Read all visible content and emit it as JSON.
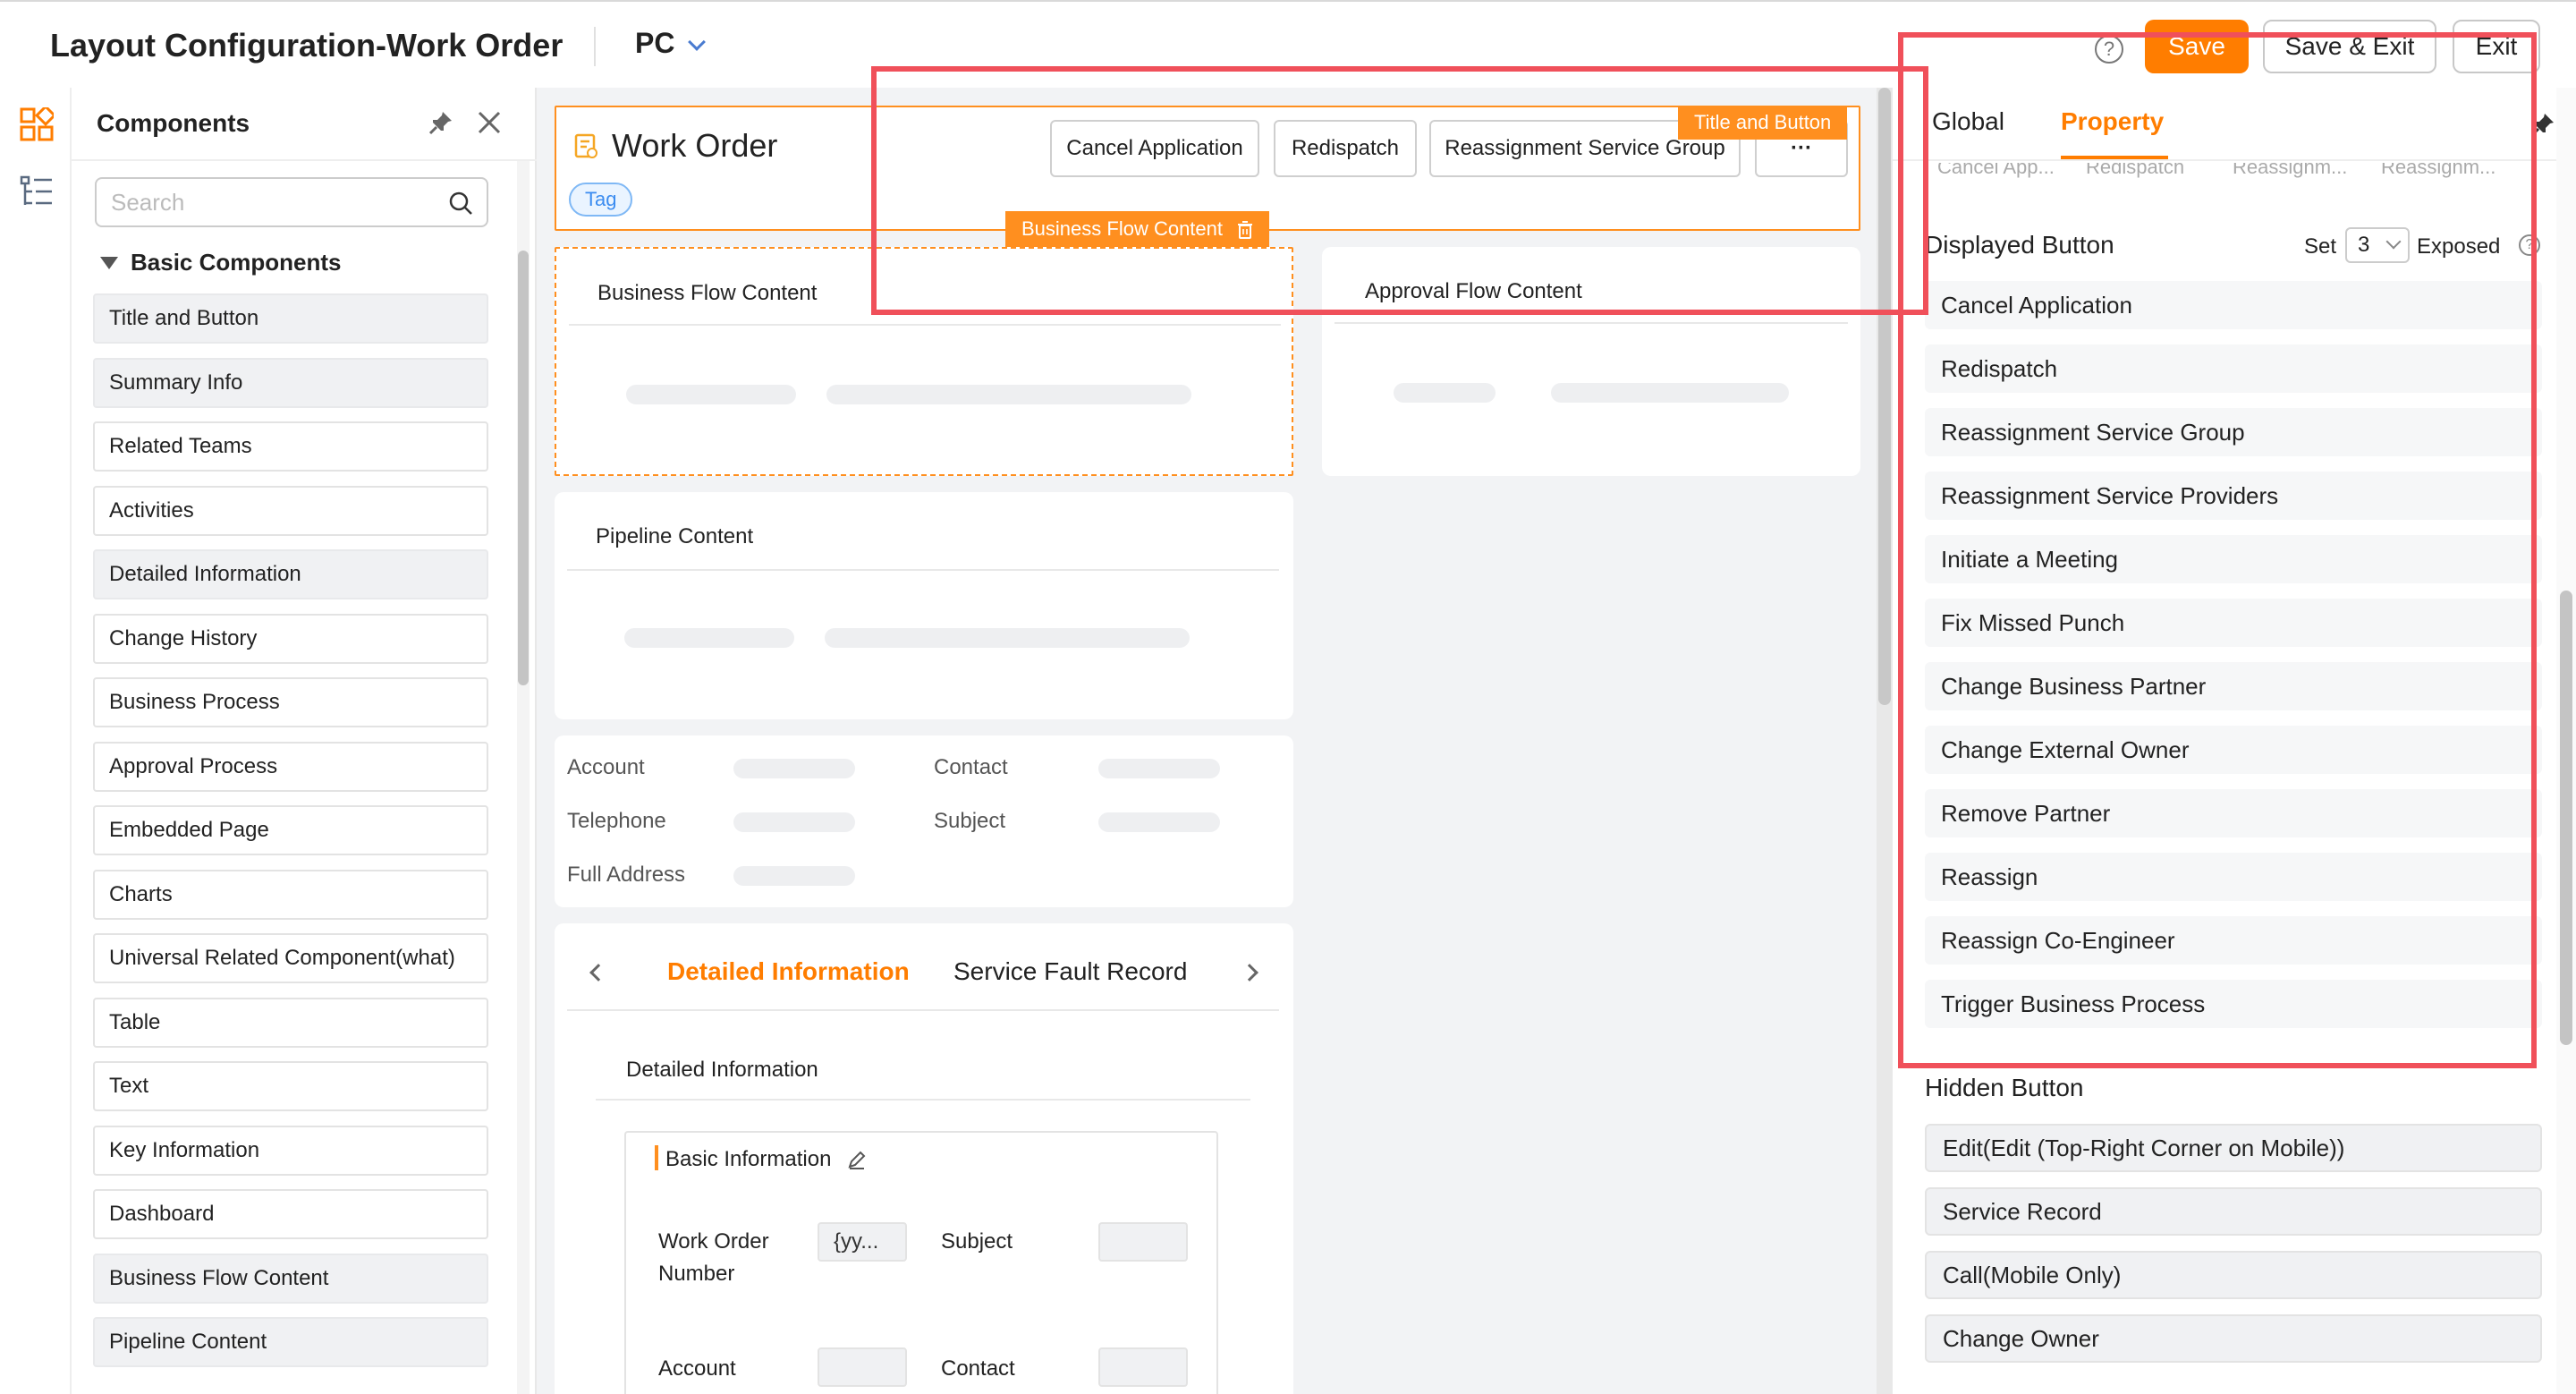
{
  "header": {
    "title": "Layout Configuration-Work Order",
    "platform": "PC",
    "help": "?",
    "save": "Save",
    "save_exit": "Save & Exit",
    "exit": "Exit"
  },
  "components": {
    "title": "Components",
    "search_placeholder": "Search",
    "group": "Basic Components",
    "items": [
      {
        "label": "Title and Button",
        "active": true
      },
      {
        "label": "Summary Info",
        "active": true
      },
      {
        "label": "Related Teams",
        "active": false
      },
      {
        "label": "Activities",
        "active": false
      },
      {
        "label": "Detailed Information",
        "active": true
      },
      {
        "label": "Change History",
        "active": false
      },
      {
        "label": "Business Process",
        "active": false
      },
      {
        "label": "Approval Process",
        "active": false
      },
      {
        "label": "Embedded Page",
        "active": false
      },
      {
        "label": "Charts",
        "active": false
      },
      {
        "label": "Universal Related Component(what)",
        "active": false
      },
      {
        "label": "Table",
        "active": false
      },
      {
        "label": "Text",
        "active": false
      },
      {
        "label": "Key Information",
        "active": false
      },
      {
        "label": "Dashboard",
        "active": false
      },
      {
        "label": "Business Flow Content",
        "active": true
      },
      {
        "label": "Pipeline Content",
        "active": true
      }
    ]
  },
  "canvas": {
    "work_order": {
      "title": "Work Order",
      "tag": "Tag",
      "buttons": [
        "Cancel Application",
        "Redispatch",
        "Reassignment Service Group"
      ],
      "more": "···",
      "component_label": "Title and Button"
    },
    "business_flow": {
      "label": "Business Flow Content",
      "title": "Business Flow Content"
    },
    "approval_flow": {
      "title": "Approval Flow Content"
    },
    "pipeline": {
      "title": "Pipeline Content"
    },
    "fields": {
      "account": "Account",
      "contact": "Contact",
      "telephone": "Telephone",
      "subject": "Subject",
      "full_address": "Full Address"
    },
    "tabs": {
      "active": "Detailed Information",
      "other": "Service Fault Record",
      "section": "Detailed Information",
      "group": "Basic Information",
      "work_order_number_1": "Work Order",
      "work_order_number_2": "Number",
      "work_order_value": "{yy...",
      "subject": "Subject",
      "account": "Account",
      "contact": "Contact"
    }
  },
  "property": {
    "tab_global": "Global",
    "tab_property": "Property",
    "truncated": [
      "Cancel App...",
      "Redispatch",
      "Reassignm...",
      "Reassignm..."
    ],
    "displayed_title": "Displayed Button",
    "set_label": "Set",
    "set_value": "3",
    "exposed_label": "Exposed",
    "displayed_buttons": [
      "Cancel Application",
      "Redispatch",
      "Reassignment Service Group",
      "Reassignment Service Providers",
      "Initiate a Meeting",
      "Fix Missed Punch",
      "Change Business Partner",
      "Change External Owner",
      "Remove Partner",
      "Reassign",
      "Reassign Co-Engineer",
      "Trigger Business Process"
    ],
    "hidden_title": "Hidden Button",
    "hidden_buttons": [
      "Edit(Edit (Top-Right Corner on Mobile))",
      "Service Record",
      "Call(Mobile Only)",
      "Change Owner"
    ]
  },
  "colors": {
    "accent": "#ff7d00",
    "highlight": "#f0505a",
    "tag_blue": "#3b8cf0"
  }
}
